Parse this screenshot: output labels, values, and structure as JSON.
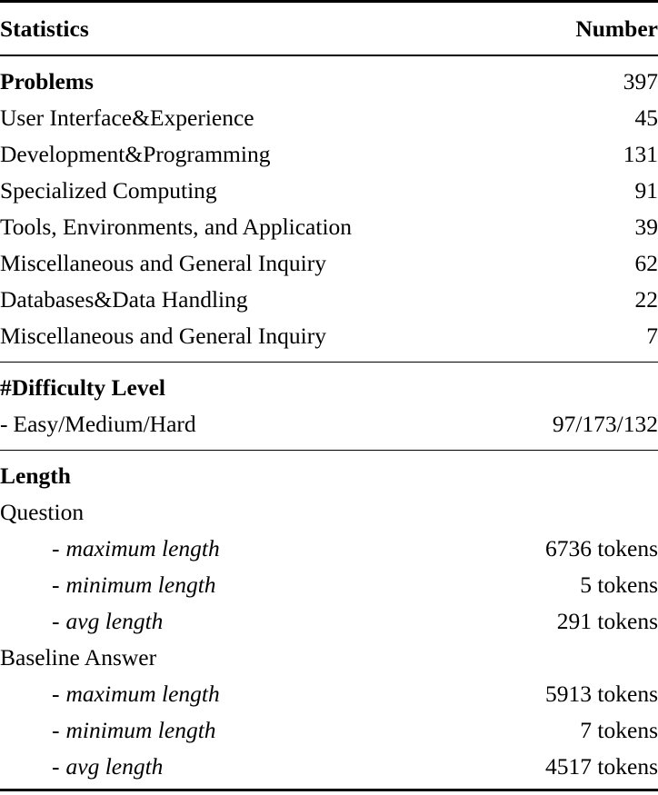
{
  "table": {
    "columns": {
      "statistics_header": "Statistics",
      "number_header": "Number"
    },
    "sections": [
      {
        "name": "problems",
        "heading": "Problems",
        "heading_value": "397",
        "rows": [
          {
            "label": "User Interface&Experience",
            "value": "45"
          },
          {
            "label": "Development&Programming",
            "value": "131"
          },
          {
            "label": "Specialized Computing",
            "value": "91"
          },
          {
            "label": "Tools, Environments, and Application",
            "value": "39"
          },
          {
            "label": "Miscellaneous and General Inquiry",
            "value": "62"
          },
          {
            "label": "Databases&Data Handling",
            "value": "22"
          },
          {
            "label": "Miscellaneous and General Inquiry",
            "value": "7"
          }
        ]
      },
      {
        "name": "difficulty",
        "heading": "#Difficulty Level",
        "rows": [
          {
            "dash": "-",
            "label": "Easy/Medium/Hard",
            "value": "97/173/132"
          }
        ]
      },
      {
        "name": "length",
        "heading": "Length",
        "groups": [
          {
            "group_label": "Question",
            "rows": [
              {
                "dash": "-",
                "label": "maximum length",
                "value": "6736 tokens"
              },
              {
                "dash": "-",
                "label": "minimum length",
                "value": "5 tokens"
              },
              {
                "dash": "-",
                "label": "avg length",
                "value": "291 tokens"
              }
            ]
          },
          {
            "group_label": "Baseline Answer",
            "rows": [
              {
                "dash": "-",
                "label": "maximum length",
                "value": "5913 tokens"
              },
              {
                "dash": "-",
                "label": "minimum length",
                "value": "7 tokens"
              },
              {
                "dash": "-",
                "label": "avg length",
                "value": "4517 tokens"
              }
            ]
          }
        ]
      }
    ]
  }
}
